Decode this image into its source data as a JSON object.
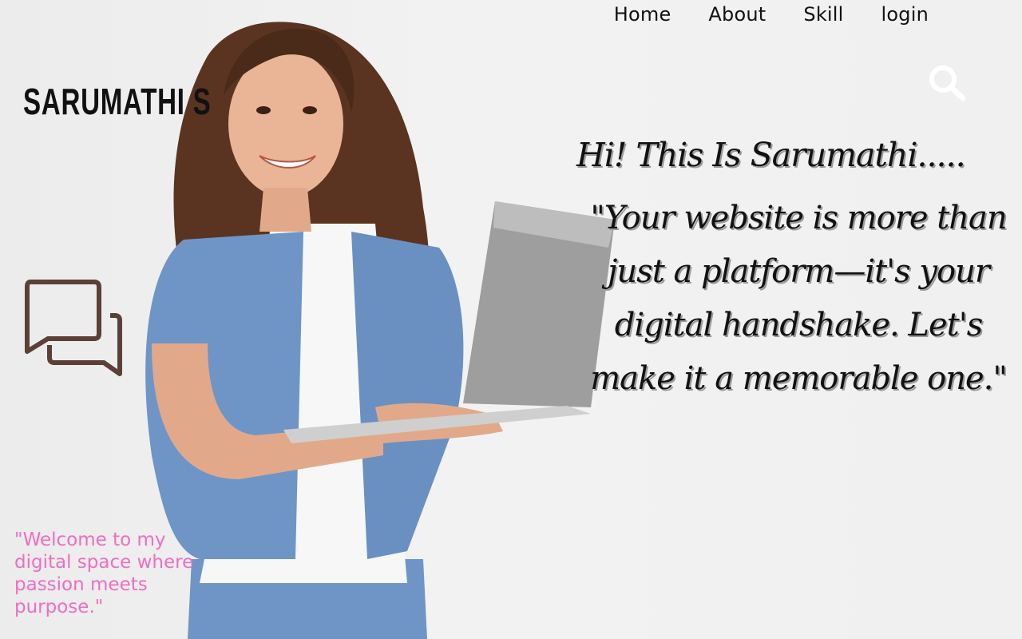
{
  "nav": {
    "items": [
      "Home",
      "About",
      "Skill",
      "login"
    ]
  },
  "brand": {
    "name": "SARUMATHI S"
  },
  "icons": {
    "search": "search-icon",
    "chat": "chat-bubbles-icon"
  },
  "hero": {
    "greeting": "Hi! This Is Sarumathi.....",
    "quote": "\"Your website is more than just a platform—it's your digital handshake. Let's make it a memorable one.\""
  },
  "tagline": "\"Welcome to my digital space where passion meets purpose.\"",
  "colors": {
    "background": "#efefef",
    "text": "#111111",
    "tagline": "#ef6ec2",
    "chat_icon": "#5b4038",
    "search_icon": "#ffffff"
  }
}
